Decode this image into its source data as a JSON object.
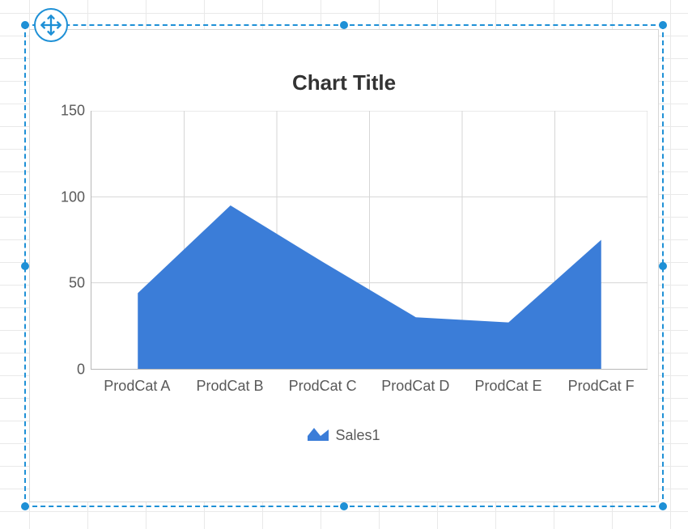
{
  "chart_data": {
    "type": "area",
    "title": "Chart Title",
    "categories": [
      "ProdCat A",
      "ProdCat B",
      "ProdCat C",
      "ProdCat D",
      "ProdCat E",
      "ProdCat F"
    ],
    "series": [
      {
        "name": "Sales1",
        "values": [
          44,
          95,
          62,
          30,
          27,
          75
        ]
      }
    ],
    "ylim": [
      0,
      150
    ],
    "y_ticks": [
      0,
      50,
      100,
      150
    ],
    "series_color": "#3b7dd8"
  },
  "legend": {
    "label": "Sales1"
  }
}
